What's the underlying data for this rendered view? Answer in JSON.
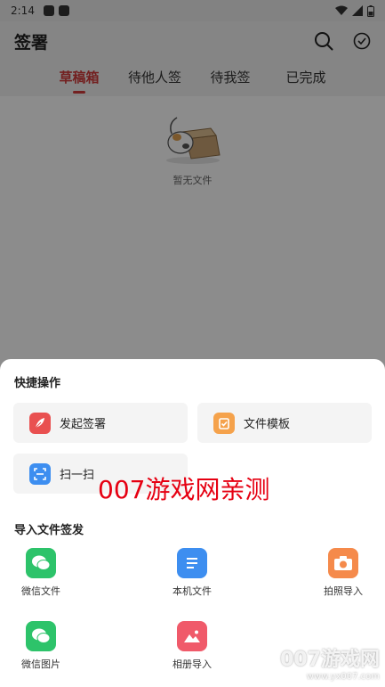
{
  "status": {
    "time": "2:14"
  },
  "appbar": {
    "title": "签署"
  },
  "tabs": [
    {
      "label": "草稿箱",
      "active": true
    },
    {
      "label": "待他人签",
      "active": false
    },
    {
      "label": "待我签",
      "active": false
    },
    {
      "label": "已完成",
      "active": false
    }
  ],
  "empty": {
    "text": "暂无文件"
  },
  "sheet": {
    "quick_title": "快捷操作",
    "quick": [
      {
        "label": "发起签署",
        "icon": "quill-icon",
        "color": "#e95050"
      },
      {
        "label": "文件模板",
        "icon": "template-icon",
        "color": "#f5a24b"
      },
      {
        "label": "扫一扫",
        "icon": "scan-icon",
        "color": "#3d8ef0"
      }
    ],
    "import_title": "导入文件签发",
    "imports": [
      {
        "label": "微信文件",
        "icon": "wechat-file-icon",
        "color": "#2dc36a"
      },
      {
        "label": "本机文件",
        "icon": "local-file-icon",
        "color": "#3d8ef0"
      },
      {
        "label": "拍照导入",
        "icon": "camera-icon",
        "color": "#f58a4b"
      },
      {
        "label": "微信图片",
        "icon": "wechat-image-icon",
        "color": "#2dc36a"
      },
      {
        "label": "相册导入",
        "icon": "album-icon",
        "color": "#f05a6a"
      }
    ]
  },
  "watermark": {
    "main": "007游戏网亲测",
    "corner_big": "007游戏网",
    "corner_small": "www.yx007.com"
  }
}
